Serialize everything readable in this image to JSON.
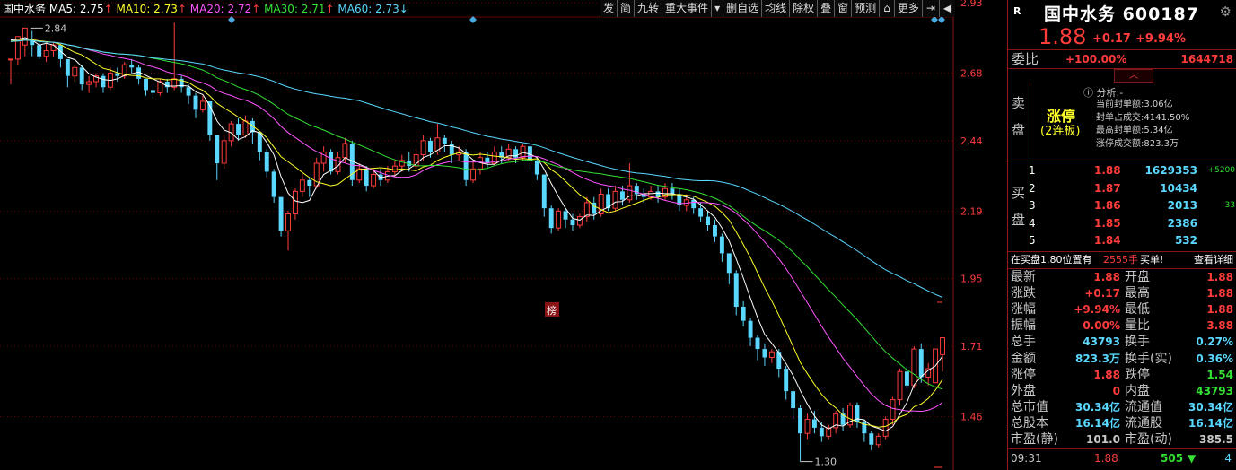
{
  "header": {
    "stock_name": "国中水务",
    "ma": [
      {
        "label": "MA5: 2.75",
        "color": "#ffffff",
        "arrow": "up"
      },
      {
        "label": "MA10: 2.73",
        "color": "#ffff2a",
        "arrow": "up"
      },
      {
        "label": "MA20: 2.72",
        "color": "#ff55ff",
        "arrow": "up"
      },
      {
        "label": "MA30: 2.71",
        "color": "#34e034",
        "arrow": "up"
      },
      {
        "label": "MA60: 2.73",
        "color": "#5ad8ff",
        "arrow": "down"
      }
    ]
  },
  "toolbar": [
    "发",
    "简",
    "九转",
    "重大事件",
    "▾",
    "删自选",
    "均线",
    "除权",
    "叠",
    "窗",
    "预测",
    "lock-icon",
    "更多",
    "exit-icon",
    "play-icon"
  ],
  "chart_data": {
    "type": "candlestick",
    "yaxis": {
      "ticks": [
        "2.93",
        "2.68",
        "2.44",
        "2.19",
        "1.95",
        "1.71",
        "1.46"
      ],
      "range": [
        1.27,
        2.94
      ]
    },
    "annotations": {
      "high_label": "2.84",
      "low_label": "1.30",
      "badge": "榜"
    },
    "candles": [
      [
        2.73,
        2.73,
        2.73,
        2.64
      ],
      [
        2.73,
        2.81,
        2.71,
        2.78
      ],
      [
        2.78,
        2.84,
        2.74,
        2.8
      ],
      [
        2.8,
        2.78,
        2.74,
        2.83
      ],
      [
        2.78,
        2.74,
        2.73,
        2.79
      ],
      [
        2.74,
        2.76,
        2.72,
        2.79
      ],
      [
        2.76,
        2.78,
        2.74,
        2.79
      ],
      [
        2.78,
        2.73,
        2.7,
        2.78
      ],
      [
        2.73,
        2.67,
        2.63,
        2.73
      ],
      [
        2.67,
        2.7,
        2.65,
        2.71
      ],
      [
        2.7,
        2.64,
        2.62,
        2.71
      ],
      [
        2.64,
        2.65,
        2.61,
        2.67
      ],
      [
        2.65,
        2.67,
        2.63,
        2.68
      ],
      [
        2.67,
        2.63,
        2.61,
        2.68
      ],
      [
        2.63,
        2.68,
        2.62,
        2.7
      ],
      [
        2.68,
        2.67,
        2.65,
        2.7
      ],
      [
        2.67,
        2.71,
        2.66,
        2.72
      ],
      [
        2.71,
        2.7,
        2.68,
        2.73
      ],
      [
        2.7,
        2.66,
        2.64,
        2.71
      ],
      [
        2.66,
        2.62,
        2.6,
        2.66
      ],
      [
        2.62,
        2.61,
        2.59,
        2.64
      ],
      [
        2.61,
        2.65,
        2.6,
        2.66
      ],
      [
        2.65,
        2.63,
        2.61,
        2.66
      ],
      [
        2.63,
        2.66,
        2.62,
        2.86
      ],
      [
        2.66,
        2.63,
        2.61,
        2.67
      ],
      [
        2.63,
        2.6,
        2.57,
        2.64
      ],
      [
        2.6,
        2.55,
        2.52,
        2.61
      ],
      [
        2.55,
        2.58,
        2.54,
        2.6
      ],
      [
        2.58,
        2.46,
        2.44,
        2.58
      ],
      [
        2.46,
        2.36,
        2.3,
        2.46
      ],
      [
        2.36,
        2.44,
        2.34,
        2.46
      ],
      [
        2.44,
        2.5,
        2.42,
        2.51
      ],
      [
        2.5,
        2.46,
        2.44,
        2.52
      ],
      [
        2.46,
        2.51,
        2.45,
        2.53
      ],
      [
        2.51,
        2.47,
        2.43,
        2.52
      ],
      [
        2.47,
        2.4,
        2.37,
        2.47
      ],
      [
        2.4,
        2.33,
        2.31,
        2.41
      ],
      [
        2.33,
        2.24,
        2.22,
        2.34
      ],
      [
        2.24,
        2.12,
        2.1,
        2.24
      ],
      [
        2.12,
        2.18,
        2.05,
        2.19
      ],
      [
        2.18,
        2.26,
        2.16,
        2.27
      ],
      [
        2.26,
        2.3,
        2.24,
        2.32
      ],
      [
        2.3,
        2.28,
        2.24,
        2.31
      ],
      [
        2.28,
        2.36,
        2.27,
        2.38
      ],
      [
        2.36,
        2.4,
        2.33,
        2.42
      ],
      [
        2.4,
        2.33,
        2.32,
        2.41
      ],
      [
        2.33,
        2.38,
        2.32,
        2.4
      ],
      [
        2.38,
        2.43,
        2.36,
        2.45
      ],
      [
        2.43,
        2.3,
        2.28,
        2.44
      ],
      [
        2.3,
        2.34,
        2.29,
        2.36
      ],
      [
        2.34,
        2.28,
        2.26,
        2.35
      ],
      [
        2.28,
        2.32,
        2.27,
        2.34
      ],
      [
        2.32,
        2.3,
        2.28,
        2.34
      ],
      [
        2.3,
        2.33,
        2.29,
        2.35
      ],
      [
        2.33,
        2.35,
        2.31,
        2.37
      ],
      [
        2.35,
        2.37,
        2.33,
        2.39
      ],
      [
        2.37,
        2.35,
        2.33,
        2.4
      ],
      [
        2.35,
        2.39,
        2.34,
        2.41
      ],
      [
        2.39,
        2.44,
        2.37,
        2.46
      ],
      [
        2.44,
        2.4,
        2.38,
        2.45
      ],
      [
        2.4,
        2.45,
        2.39,
        2.5
      ],
      [
        2.45,
        2.43,
        2.4,
        2.46
      ],
      [
        2.43,
        2.39,
        2.36,
        2.44
      ],
      [
        2.39,
        2.4,
        2.37,
        2.42
      ],
      [
        2.4,
        2.3,
        2.28,
        2.41
      ],
      [
        2.3,
        2.34,
        2.29,
        2.37
      ],
      [
        2.34,
        2.38,
        2.32,
        2.4
      ],
      [
        2.38,
        2.36,
        2.34,
        2.4
      ],
      [
        2.36,
        2.4,
        2.35,
        2.42
      ],
      [
        2.4,
        2.38,
        2.36,
        2.42
      ],
      [
        2.38,
        2.41,
        2.37,
        2.43
      ],
      [
        2.41,
        2.38,
        2.36,
        2.42
      ],
      [
        2.38,
        2.42,
        2.37,
        2.43
      ],
      [
        2.42,
        2.37,
        2.34,
        2.43
      ],
      [
        2.37,
        2.32,
        2.3,
        2.38
      ],
      [
        2.32,
        2.2,
        2.17,
        2.32
      ],
      [
        2.2,
        2.13,
        2.11,
        2.21
      ],
      [
        2.13,
        2.19,
        2.12,
        2.2
      ],
      [
        2.19,
        2.16,
        2.13,
        2.2
      ],
      [
        2.16,
        2.14,
        2.12,
        2.18
      ],
      [
        2.14,
        2.17,
        2.13,
        2.18
      ],
      [
        2.17,
        2.22,
        2.15,
        2.24
      ],
      [
        2.22,
        2.18,
        2.16,
        2.24
      ],
      [
        2.18,
        2.25,
        2.17,
        2.27
      ],
      [
        2.25,
        2.2,
        2.19,
        2.27
      ],
      [
        2.2,
        2.26,
        2.19,
        2.28
      ],
      [
        2.26,
        2.23,
        2.21,
        2.28
      ],
      [
        2.23,
        2.28,
        2.22,
        2.36
      ],
      [
        2.28,
        2.25,
        2.23,
        2.29
      ],
      [
        2.25,
        2.24,
        2.22,
        2.27
      ],
      [
        2.24,
        2.26,
        2.23,
        2.28
      ],
      [
        2.26,
        2.24,
        2.22,
        2.28
      ],
      [
        2.24,
        2.27,
        2.23,
        2.29
      ],
      [
        2.27,
        2.25,
        2.23,
        2.29
      ],
      [
        2.25,
        2.21,
        2.19,
        2.27
      ],
      [
        2.21,
        2.23,
        2.19,
        2.25
      ],
      [
        2.23,
        2.2,
        2.18,
        2.24
      ],
      [
        2.2,
        2.17,
        2.15,
        2.22
      ],
      [
        2.17,
        2.14,
        2.12,
        2.19
      ],
      [
        2.14,
        2.1,
        2.08,
        2.16
      ],
      [
        2.1,
        2.04,
        2.01,
        2.11
      ],
      [
        2.04,
        1.97,
        1.93,
        2.04
      ],
      [
        1.97,
        1.85,
        1.82,
        1.98
      ],
      [
        1.85,
        1.8,
        1.78,
        1.87
      ],
      [
        1.8,
        1.74,
        1.71,
        1.81
      ],
      [
        1.74,
        1.7,
        1.66,
        1.75
      ],
      [
        1.7,
        1.67,
        1.64,
        1.72
      ],
      [
        1.67,
        1.69,
        1.65,
        1.7
      ],
      [
        1.69,
        1.63,
        1.6,
        1.7
      ],
      [
        1.63,
        1.55,
        1.52,
        1.64
      ],
      [
        1.55,
        1.49,
        1.45,
        1.56
      ],
      [
        1.49,
        1.4,
        1.3,
        1.5
      ],
      [
        1.4,
        1.45,
        1.38,
        1.47
      ],
      [
        1.45,
        1.42,
        1.4,
        1.48
      ],
      [
        1.42,
        1.39,
        1.37,
        1.44
      ],
      [
        1.39,
        1.42,
        1.38,
        1.43
      ],
      [
        1.42,
        1.47,
        1.4,
        1.48
      ],
      [
        1.47,
        1.43,
        1.41,
        1.49
      ],
      [
        1.43,
        1.5,
        1.42,
        1.51
      ],
      [
        1.5,
        1.44,
        1.42,
        1.51
      ],
      [
        1.44,
        1.4,
        1.37,
        1.45
      ],
      [
        1.4,
        1.36,
        1.34,
        1.41
      ],
      [
        1.36,
        1.39,
        1.35,
        1.4
      ],
      [
        1.39,
        1.45,
        1.38,
        1.46
      ],
      [
        1.45,
        1.52,
        1.43,
        1.53
      ],
      [
        1.52,
        1.62,
        1.5,
        1.63
      ],
      [
        1.62,
        1.57,
        1.55,
        1.64
      ],
      [
        1.57,
        1.7,
        1.56,
        1.71
      ],
      [
        1.7,
        1.6,
        1.58,
        1.72
      ],
      [
        1.6,
        1.63,
        1.57,
        1.65
      ],
      [
        1.58,
        1.7,
        1.58,
        1.7
      ],
      [
        1.68,
        1.74,
        1.62,
        1.74
      ]
    ],
    "ma_series": [
      {
        "name": "MA5",
        "color": "#ffffff"
      },
      {
        "name": "MA10",
        "color": "#ffff2a"
      },
      {
        "name": "MA20",
        "color": "#ff55ff"
      },
      {
        "name": "MA30",
        "color": "#34e034"
      },
      {
        "name": "MA60",
        "color": "#5ad8ff"
      }
    ],
    "ma_history": [
      2.78,
      2.79,
      2.8,
      2.79,
      2.78,
      2.79,
      2.8,
      2.81,
      2.82,
      2.83
    ]
  },
  "panel": {
    "r_badge": "R",
    "name": "国中水务",
    "code": "600187",
    "price": "1.88",
    "change": "+0.17",
    "change_pct": "+9.94%",
    "wei_label": "委比",
    "wei_pct": "+100.00%",
    "wei_value": "1644718",
    "sell_label": "卖盘",
    "buy_label": "买盘",
    "limit_up": "涨停",
    "limit_days": "(2连板)",
    "analysis": "分析:-",
    "seal_info": [
      "当前封单额:3.06亿",
      "封单占成交:4141.50%",
      "最高封单额:5.34亿",
      "涨停成交额:823.3万"
    ],
    "bids": [
      {
        "level": "1",
        "price": "1.88",
        "vol": "1629353",
        "chg": "+5200"
      },
      {
        "level": "2",
        "price": "1.87",
        "vol": "10434",
        "chg": ""
      },
      {
        "level": "3",
        "price": "1.86",
        "vol": "2013",
        "chg": "-33"
      },
      {
        "level": "4",
        "price": "1.85",
        "vol": "2386",
        "chg": ""
      },
      {
        "level": "5",
        "price": "1.84",
        "vol": "532",
        "chg": ""
      }
    ],
    "buy_notice": {
      "text": "在买盘1.80位置有",
      "vol": "2555手",
      "tail": "买单!",
      "link": "查看详细"
    },
    "stats": [
      {
        "l1": "最新",
        "v1": "1.88",
        "c1": "red",
        "l2": "开盘",
        "v2": "1.88",
        "c2": "red"
      },
      {
        "l1": "涨跌",
        "v1": "+0.17",
        "c1": "red",
        "l2": "最高",
        "v2": "1.88",
        "c2": "red"
      },
      {
        "l1": "涨幅",
        "v1": "+9.94%",
        "c1": "red",
        "l2": "最低",
        "v2": "1.88",
        "c2": "red"
      },
      {
        "l1": "振幅",
        "v1": "0.00%",
        "c1": "red",
        "l2": "量比",
        "v2": "3.88",
        "c2": "red"
      },
      {
        "l1": "总手",
        "v1": "43793",
        "c1": "cyan",
        "l2": "换手",
        "v2": "0.27%",
        "c2": "cyan"
      },
      {
        "l1": "金额",
        "v1": "823.3万",
        "c1": "cyan",
        "l2": "换手(实)",
        "v2": "0.36%",
        "c2": "cyan"
      },
      {
        "l1": "涨停",
        "v1": "1.88",
        "c1": "red",
        "l2": "跌停",
        "v2": "1.54",
        "c2": "green"
      },
      {
        "l1": "外盘",
        "v1": "0",
        "c1": "red",
        "l2": "内盘",
        "v2": "43793",
        "c2": "green"
      },
      {
        "l1": "总市值",
        "v1": "30.34亿",
        "c1": "cyan",
        "l2": "流通值",
        "v2": "30.34亿",
        "c2": "cyan"
      },
      {
        "l1": "总股本",
        "v1": "16.14亿",
        "c1": "cyan",
        "l2": "流通股",
        "v2": "16.14亿",
        "c2": "cyan"
      },
      {
        "l1": "市盈(静)",
        "v1": "101.0",
        "c1": "grey",
        "l2": "市盈(动)",
        "v2": "385.5",
        "c2": "grey"
      }
    ],
    "footer": {
      "time": "09:31",
      "price": "1.88",
      "vol": "505",
      "count": "4"
    },
    "colors": {
      "up": "#ff3c3c",
      "down": "#34e034",
      "value": "#5ad8ff"
    }
  }
}
